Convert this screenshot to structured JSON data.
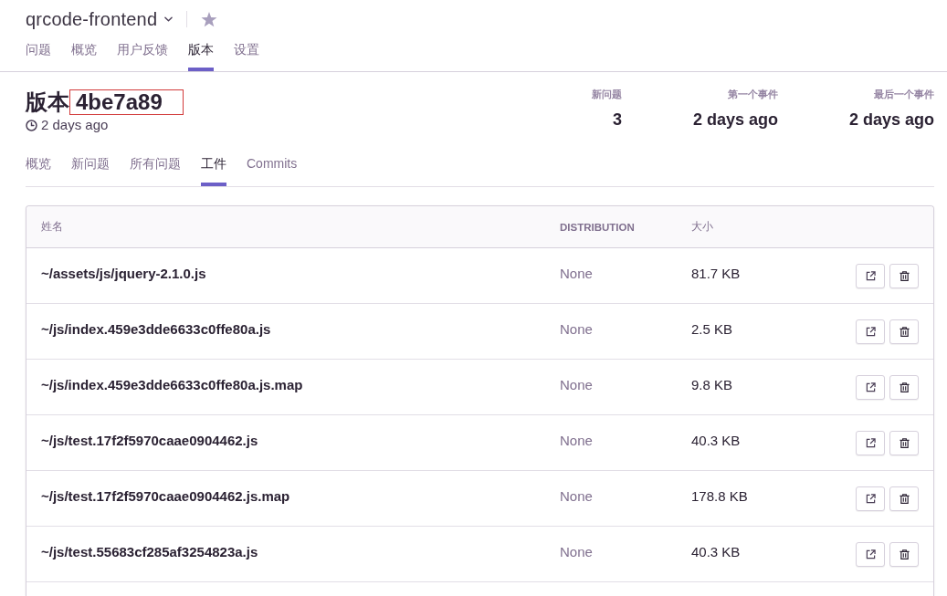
{
  "header": {
    "project": "qrcode-frontend",
    "starred": false
  },
  "nav_tabs": [
    {
      "label": "问题",
      "selected": false
    },
    {
      "label": "概览",
      "selected": false
    },
    {
      "label": "用户反馈",
      "selected": false
    },
    {
      "label": "版本",
      "selected": true
    },
    {
      "label": "设置",
      "selected": false
    }
  ],
  "release": {
    "label": "版本",
    "version": "4be7a89",
    "version_highlighted": true,
    "created": "2 days ago"
  },
  "stats": [
    {
      "label": "新问题",
      "value": "3"
    },
    {
      "label": "第一个事件",
      "value": "2 days ago"
    },
    {
      "label": "最后一个事件",
      "value": "2 days ago"
    }
  ],
  "sub_tabs": [
    {
      "label": "概览",
      "selected": false
    },
    {
      "label": "新问题",
      "selected": false
    },
    {
      "label": "所有问题",
      "selected": false
    },
    {
      "label": "工件",
      "selected": true
    },
    {
      "label": "Commits",
      "selected": false
    }
  ],
  "table": {
    "columns": [
      "姓名",
      "DISTRIBUTION",
      "大小"
    ],
    "rows": [
      {
        "name": "~/assets/js/jquery-2.1.0.js",
        "distribution": "None",
        "size": "81.7 KB"
      },
      {
        "name": "~/js/index.459e3dde6633c0ffe80a.js",
        "distribution": "None",
        "size": "2.5 KB"
      },
      {
        "name": "~/js/index.459e3dde6633c0ffe80a.js.map",
        "distribution": "None",
        "size": "9.8 KB"
      },
      {
        "name": "~/js/test.17f2f5970caae0904462.js",
        "distribution": "None",
        "size": "40.3 KB"
      },
      {
        "name": "~/js/test.17f2f5970caae0904462.js.map",
        "distribution": "None",
        "size": "178.8 KB"
      },
      {
        "name": "~/js/test.55683cf285af3254823a.js",
        "distribution": "None",
        "size": "40.3 KB"
      }
    ]
  }
}
